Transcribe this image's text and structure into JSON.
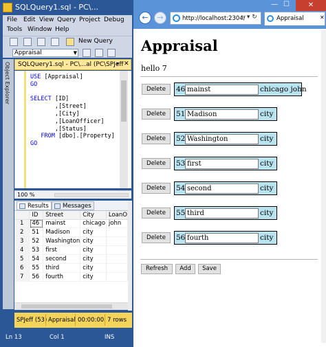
{
  "ssms": {
    "title": "SQLQuery1.sql - PC\\...",
    "menu": [
      "File",
      "Edit",
      "View",
      "Query",
      "Project",
      "Debug",
      "Tools",
      "Window",
      "Help"
    ],
    "new_query_label": "New Query",
    "database": "Appraisal",
    "object_explorer_label": "Object Explorer",
    "doc_tab": "SQLQuery1.sql - PC\\...al (PC\\SPJeff",
    "code_lines": {
      "l1a": "USE ",
      "l1b": "[Appraisal]",
      "l2": "GO",
      "l3a": "SELECT ",
      "l3b": "[ID]",
      "l4": ",[Street]",
      "l5": ",[City]",
      "l6": ",[LoanOfficer]",
      "l7": ",[Status]",
      "l8a": "FROM ",
      "l8b": "[dbo].[Property]",
      "l9": "GO"
    },
    "zoom": "100 %",
    "results_tab": "Results",
    "messages_tab": "Messages",
    "grid": {
      "columns": [
        "",
        "ID",
        "Street",
        "City",
        "LoanO"
      ],
      "rows": [
        [
          "1",
          "46",
          "mainst",
          "chicago",
          "john"
        ],
        [
          "2",
          "51",
          "Madison",
          "city",
          ""
        ],
        [
          "3",
          "52",
          "Washington",
          "city",
          ""
        ],
        [
          "4",
          "53",
          "first",
          "city",
          ""
        ],
        [
          "5",
          "54",
          "second",
          "city",
          ""
        ],
        [
          "6",
          "55",
          "third",
          "city",
          ""
        ],
        [
          "7",
          "56",
          "fourth",
          "city",
          ""
        ]
      ]
    },
    "query_status": {
      "server": "SPJeff (53)",
      "db": "Appraisal",
      "time": "00:00:00",
      "rows": "7 rows"
    },
    "status_bar": {
      "ln": "Ln 13",
      "col": "Col 1",
      "ins": "INS"
    }
  },
  "browser": {
    "url": "http://localhost:2304/",
    "tab_title": "Appraisal",
    "heading": "Appraisal",
    "hello": "hello 7",
    "delete_label": "Delete",
    "records": [
      {
        "id": "46",
        "street": "mainst",
        "city": "chicago john"
      },
      {
        "id": "51",
        "street": "Madison",
        "city": "city"
      },
      {
        "id": "52",
        "street": "Washington",
        "city": "city"
      },
      {
        "id": "53",
        "street": "first",
        "city": "city"
      },
      {
        "id": "54",
        "street": "second",
        "city": "city"
      },
      {
        "id": "55",
        "street": "third",
        "city": "city"
      },
      {
        "id": "56",
        "street": "fourth",
        "city": "city"
      }
    ],
    "buttons": {
      "refresh": "Refresh",
      "add": "Add",
      "save": "Save"
    }
  },
  "colors": {
    "ssms_chrome": "#2b5797",
    "browser_frame": "#5b93d8",
    "record_bg": "#b9e3ef",
    "query_status_bg": "#f4d45a",
    "tab_yellow": "#ffe89a"
  }
}
